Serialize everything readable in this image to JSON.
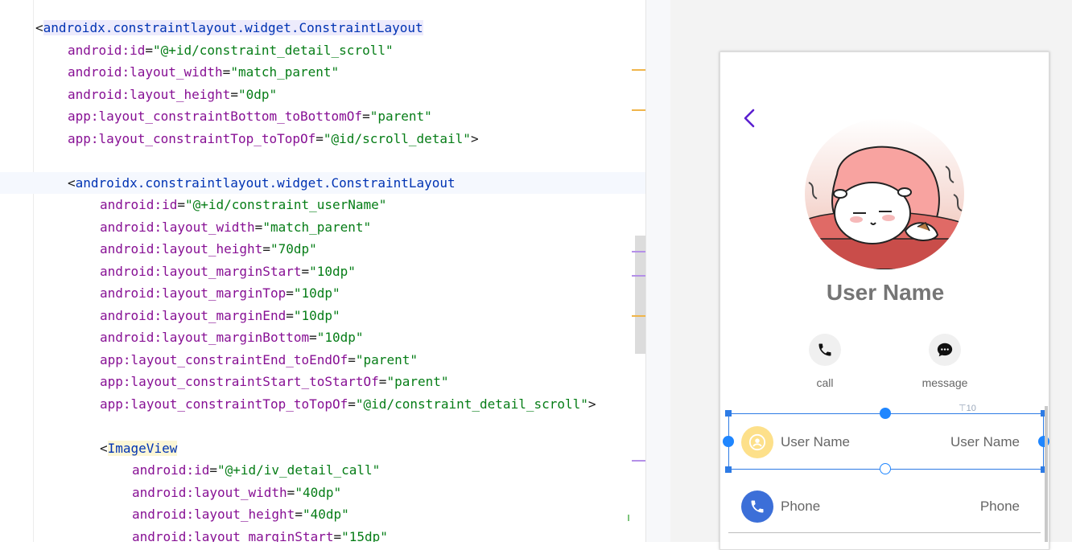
{
  "code_lines": [
    {
      "indent": 1,
      "kind": "tag",
      "tag": "androidx.constraintlayout.widget.ConstraintLayout",
      "tag_hl": "box"
    },
    {
      "indent": 2,
      "kind": "attr",
      "ns": "android",
      "attr": "id",
      "value": "\"@+id/constraint_detail_scroll\""
    },
    {
      "indent": 2,
      "kind": "attr",
      "ns": "android",
      "attr": "layout_width",
      "value": "\"match_parent\""
    },
    {
      "indent": 2,
      "kind": "attr",
      "ns": "android",
      "attr": "layout_height",
      "value": "\"0dp\""
    },
    {
      "indent": 2,
      "kind": "attr",
      "ns": "app",
      "attr": "layout_constraintBottom_toBottomOf",
      "value": "\"parent\""
    },
    {
      "indent": 2,
      "kind": "attr",
      "ns": "app",
      "attr": "layout_constraintTop_toTopOf",
      "value": "\"@id/scroll_detail\"",
      "close": ">"
    },
    {
      "indent": 0,
      "kind": "blank"
    },
    {
      "indent": 2,
      "kind": "tag",
      "tag": "androidx.constraintlayout.widget.ConstraintLayout",
      "highlight": true
    },
    {
      "indent": 3,
      "kind": "attr",
      "ns": "android",
      "attr": "id",
      "value": "\"@+id/constraint_userName\""
    },
    {
      "indent": 3,
      "kind": "attr",
      "ns": "android",
      "attr": "layout_width",
      "value": "\"match_parent\""
    },
    {
      "indent": 3,
      "kind": "attr",
      "ns": "android",
      "attr": "layout_height",
      "value": "\"70dp\""
    },
    {
      "indent": 3,
      "kind": "attr",
      "ns": "android",
      "attr": "layout_marginStart",
      "value": "\"10dp\""
    },
    {
      "indent": 3,
      "kind": "attr",
      "ns": "android",
      "attr": "layout_marginTop",
      "value": "\"10dp\""
    },
    {
      "indent": 3,
      "kind": "attr",
      "ns": "android",
      "attr": "layout_marginEnd",
      "value": "\"10dp\""
    },
    {
      "indent": 3,
      "kind": "attr",
      "ns": "android",
      "attr": "layout_marginBottom",
      "value": "\"10dp\""
    },
    {
      "indent": 3,
      "kind": "attr",
      "ns": "app",
      "attr": "layout_constraintEnd_toEndOf",
      "value": "\"parent\""
    },
    {
      "indent": 3,
      "kind": "attr",
      "ns": "app",
      "attr": "layout_constraintStart_toStartOf",
      "value": "\"parent\""
    },
    {
      "indent": 3,
      "kind": "attr",
      "ns": "app",
      "attr": "layout_constraintTop_toTopOf",
      "value": "\"@id/constraint_detail_scroll\"",
      "close": ">"
    },
    {
      "indent": 0,
      "kind": "blank"
    },
    {
      "indent": 3,
      "kind": "tag",
      "tag": "ImageView",
      "tag_hl": "yellow"
    },
    {
      "indent": 4,
      "kind": "attr",
      "ns": "android",
      "attr": "id",
      "value": "\"@+id/iv_detail_call\""
    },
    {
      "indent": 4,
      "kind": "attr",
      "ns": "android",
      "attr": "layout_width",
      "value": "\"40dp\""
    },
    {
      "indent": 4,
      "kind": "attr",
      "ns": "android",
      "attr": "layout_height",
      "value": "\"40dp\""
    },
    {
      "indent": 4,
      "kind": "attr",
      "ns": "android",
      "attr": "layout_marginStart",
      "value": "\"15dp\""
    }
  ],
  "gutter_marker_colors": {
    "orange": "#f0b54a",
    "purple": "#b490e8",
    "green": "#7cc47a"
  },
  "preview": {
    "user_name_title": "User Name",
    "call_label": "call",
    "message_label": "message",
    "rows": [
      {
        "left": "User Name",
        "right": "User Name",
        "icon": "person-icon",
        "icon_bg": "#fde08a",
        "icon_color": "#ffffff"
      },
      {
        "left": "Phone",
        "right": "Phone",
        "icon": "phone-icon",
        "icon_bg": "#3c6fd8",
        "icon_color": "#ffffff"
      }
    ],
    "margin_indicator": "10",
    "accent_color": "#5b1fd0",
    "selection_color": "#2d7be5"
  }
}
